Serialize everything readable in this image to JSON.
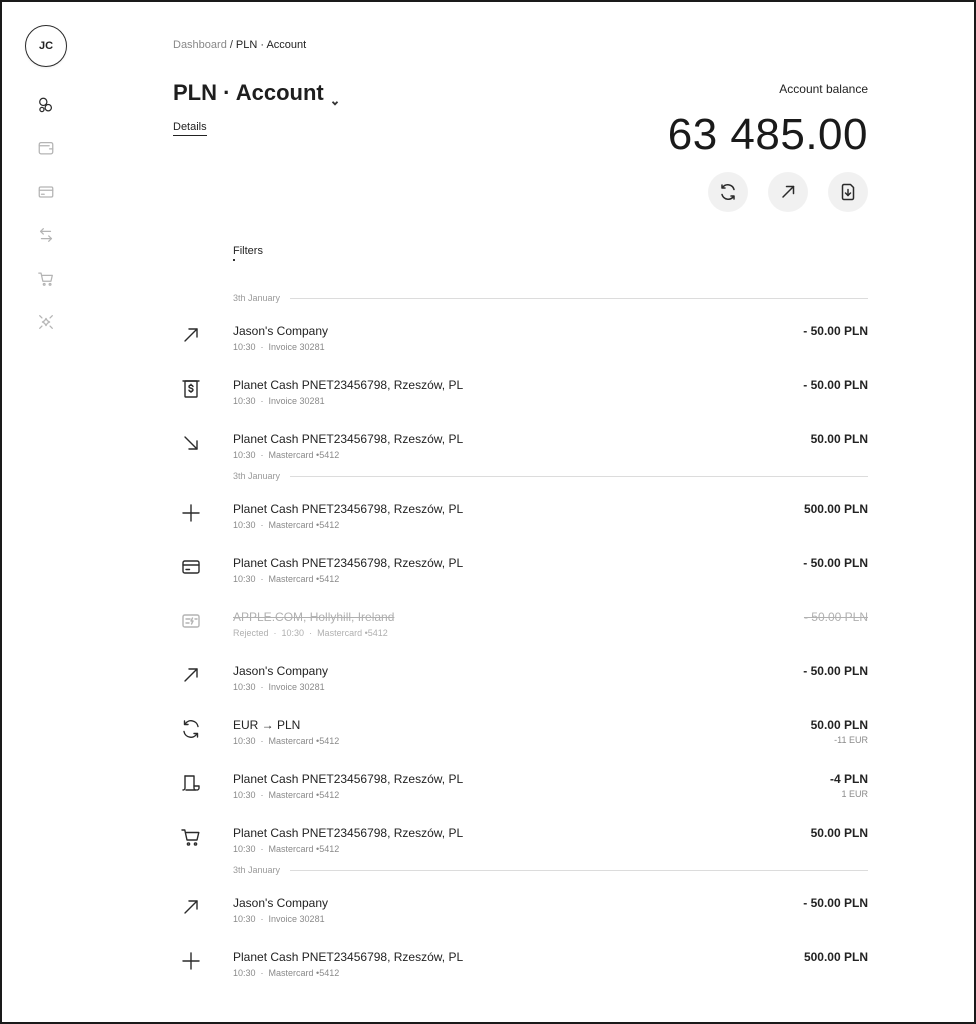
{
  "user": {
    "initials": "JC"
  },
  "sidebar": {
    "items": [
      {
        "icon": "coins-icon",
        "active": true
      },
      {
        "icon": "wallet-icon",
        "active": false
      },
      {
        "icon": "card-icon",
        "active": false
      },
      {
        "icon": "transfer-icon",
        "active": false
      },
      {
        "icon": "cart-icon",
        "active": false
      },
      {
        "icon": "sparkle-icon",
        "active": false
      }
    ]
  },
  "breadcrumb": {
    "root": "Dashboard",
    "separator": "/",
    "current": "PLN · Account"
  },
  "header": {
    "title": "PLN · Account",
    "details_label": "Details"
  },
  "balance": {
    "label": "Account balance",
    "value": "63 485.00"
  },
  "actions": [
    {
      "icon": "exchange-icon"
    },
    {
      "icon": "send-icon"
    },
    {
      "icon": "download-icon"
    }
  ],
  "filters": {
    "label": "Filters"
  },
  "transactions": [
    {
      "type": "date",
      "label": "3th January"
    },
    {
      "type": "tx",
      "icon": "outgoing-arrow-icon",
      "name": "Jason's Company",
      "meta": [
        "10:30",
        "Invoice 30281"
      ],
      "amount": "- 50.00 PLN"
    },
    {
      "type": "tx",
      "icon": "cash-icon",
      "name": "Planet Cash PNET23456798, Rzeszów, PL",
      "meta": [
        "10:30",
        "Invoice 30281"
      ],
      "amount": "- 50.00 PLN"
    },
    {
      "type": "tx",
      "icon": "incoming-arrow-icon",
      "name": "Planet Cash PNET23456798, Rzeszów, PL",
      "meta": [
        "10:30",
        "Mastercard •5412"
      ],
      "amount": "50.00 PLN"
    },
    {
      "type": "date",
      "label": "3th January"
    },
    {
      "type": "tx",
      "icon": "plus-icon",
      "name": "Planet Cash PNET23456798, Rzeszów, PL",
      "meta": [
        "10:30",
        "Mastercard •5412"
      ],
      "amount": "500.00 PLN"
    },
    {
      "type": "tx",
      "icon": "card-icon",
      "name": "Planet Cash PNET23456798, Rzeszów, PL",
      "meta": [
        "10:30",
        "Mastercard •5412"
      ],
      "amount": "- 50.00 PLN"
    },
    {
      "type": "tx",
      "icon": "card-rejected-icon",
      "rejected": true,
      "name": "APPLE.COM, Hollyhill, Ireland",
      "meta": [
        "Rejected",
        "10:30",
        "Mastercard •5412"
      ],
      "amount": "- 50.00 PLN"
    },
    {
      "type": "tx",
      "icon": "outgoing-arrow-icon",
      "name": "Jason's Company",
      "meta": [
        "10:30",
        "Invoice 30281"
      ],
      "amount": "- 50.00 PLN"
    },
    {
      "type": "tx",
      "icon": "exchange-icon",
      "name": "EUR → PLN",
      "meta": [
        "10:30",
        "Mastercard •5412"
      ],
      "amount": "50.00 PLN",
      "sub": "-11 EUR"
    },
    {
      "type": "tx",
      "icon": "receipt-icon",
      "name": "Planet Cash PNET23456798, Rzeszów, PL",
      "meta": [
        "10:30",
        "Mastercard •5412"
      ],
      "amount": "-4 PLN",
      "sub": "1 EUR"
    },
    {
      "type": "tx",
      "icon": "cart-icon",
      "name": "Planet Cash PNET23456798, Rzeszów, PL",
      "meta": [
        "10:30",
        "Mastercard •5412"
      ],
      "amount": "50.00 PLN"
    },
    {
      "type": "date",
      "label": "3th January"
    },
    {
      "type": "tx",
      "icon": "outgoing-arrow-icon",
      "name": "Jason's Company",
      "meta": [
        "10:30",
        "Invoice 30281"
      ],
      "amount": "- 50.00 PLN"
    },
    {
      "type": "tx",
      "icon": "plus-icon",
      "name": "Planet Cash PNET23456798, Rzeszów, PL",
      "meta": [
        "10:30",
        "Mastercard •5412"
      ],
      "amount": "500.00 PLN"
    }
  ]
}
